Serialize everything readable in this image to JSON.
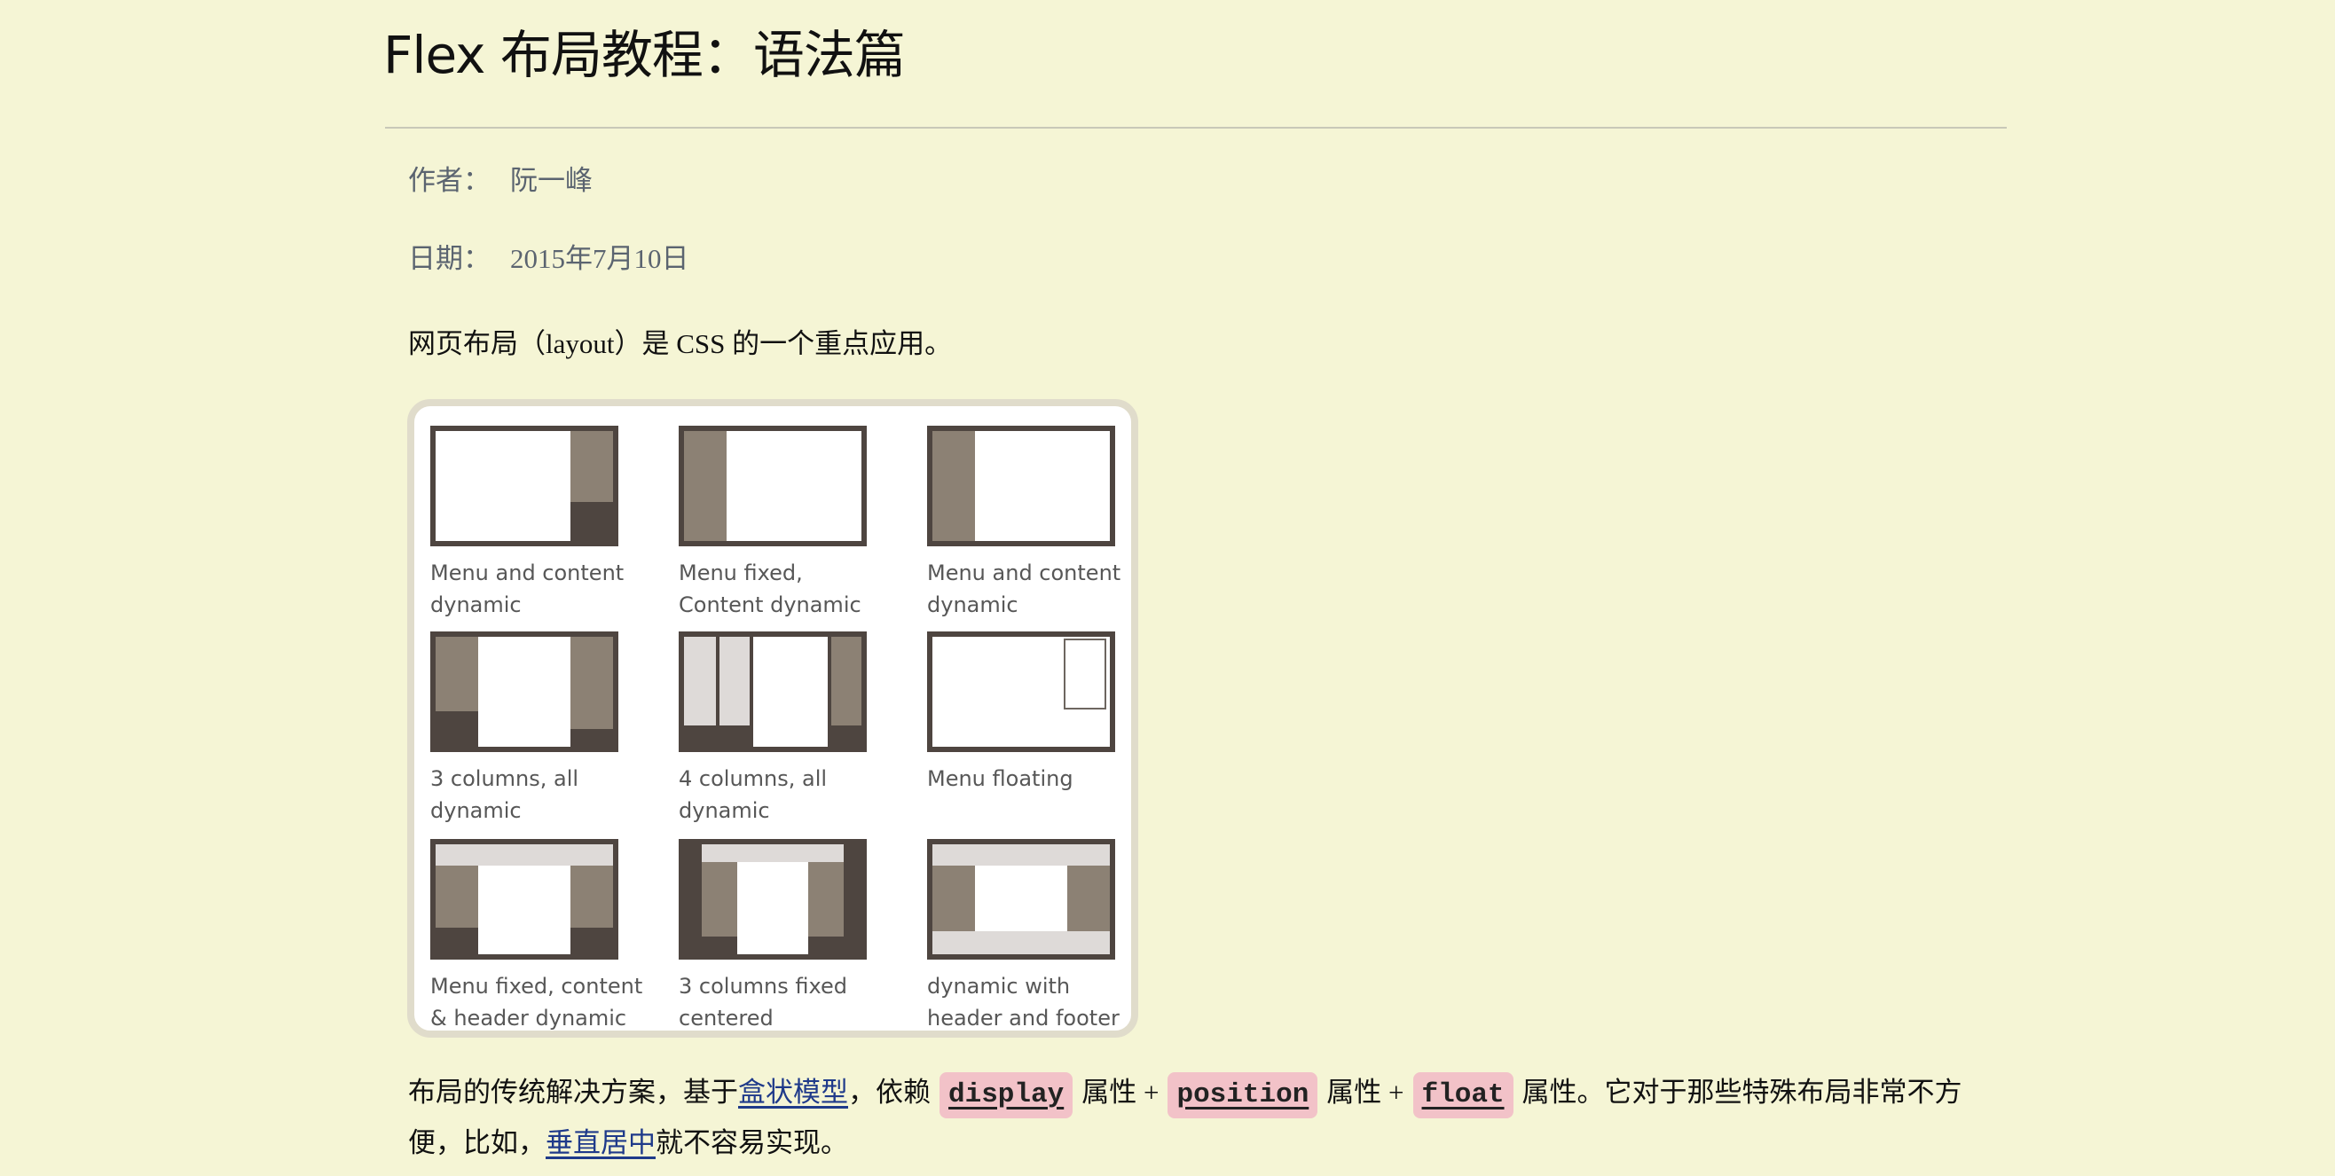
{
  "article": {
    "title": "Flex 布局教程：语法篇",
    "author_label": "作者：",
    "author": "阮一峰",
    "date_label": "日期：",
    "date": "2015年7月10日",
    "intro": "网页布局（layout）是 CSS 的一个重点应用。"
  },
  "figure": {
    "captions": [
      "Menu and content dynamic",
      "Menu fixed, Content dynamic",
      "Menu and content dynamic",
      "3 columns, all dynamic",
      "4 columns, all dynamic",
      "Menu floating",
      "Menu fixed, content & header dynamic",
      "3 columns fixed centered",
      "dynamic with header and footer"
    ]
  },
  "paragraph2": {
    "t1": "布局的传统解决方案，基于",
    "link_box_model": "盒状模型",
    "t2": "，依赖",
    "code_display": "display",
    "t3": "属性 +",
    "code_position": "position",
    "t4": "属性 +",
    "code_float": "float",
    "t5": "属性。它对于那些特殊布局非常不方便，比如，",
    "link_vertical_center": "垂直居中",
    "t6": "就不容易实现。"
  },
  "colors": {
    "background": "#f5f5d5",
    "link": "#1f3a8a",
    "code_background": "#f2c2c8",
    "thumb_frame": "#4e4540",
    "thumb_texture": "#8c8174"
  }
}
